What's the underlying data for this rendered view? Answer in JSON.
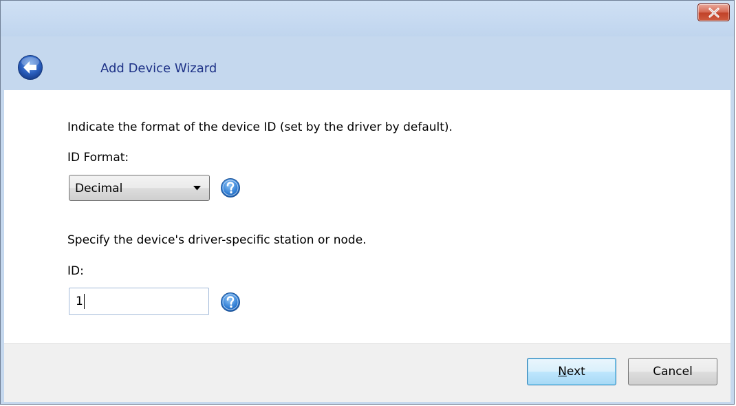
{
  "window": {
    "close_icon": "close-x-icon"
  },
  "header": {
    "title": "Add Device Wizard",
    "back_icon": "back-arrow-icon"
  },
  "id_format": {
    "instruction": "Indicate the format of the device ID (set by the driver by default).",
    "label": "ID Format:",
    "selected": "Decimal",
    "help_icon": "help-icon"
  },
  "device_id": {
    "instruction": "Specify the device's driver-specific station or node.",
    "label": "ID:",
    "value": "1",
    "help_icon": "help-icon"
  },
  "buttons": {
    "next_mnemonic": "N",
    "next_rest": "ext",
    "cancel": "Cancel"
  },
  "colors": {
    "title_text": "#1e3287",
    "header_bg": "#c5d8ee",
    "close_red": "#c1432a"
  }
}
